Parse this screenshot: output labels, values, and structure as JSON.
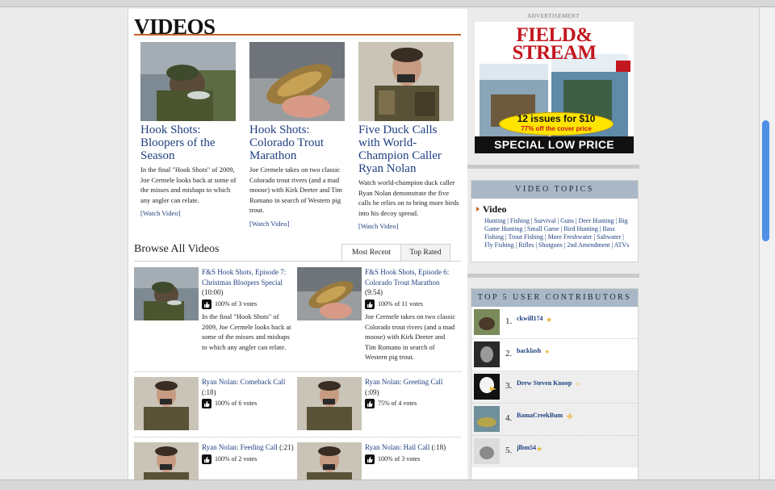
{
  "page": {
    "title": "VIDEOS",
    "features": [
      {
        "title": "Hook Shots: Bloopers of the Season",
        "desc": "In the final \"Hook Shots\" of 2009, Joe Cermele looks back at some of the misses and mishaps to which any angler can relate.",
        "link": "[Watch Video]"
      },
      {
        "title": "Hook Shots: Colorado Trout Marathon",
        "desc": "Joe Cermele takes on two classic Colorado trout rivers (and a mad moose) with Kirk Deeter and Tim Romano in search of Western pig trout.",
        "link": "[Watch Video]"
      },
      {
        "title": "Five Duck Calls with World-Champion Caller Ryan Nolan",
        "desc": "Watch world-champion duck caller Ryan Nolan demonstrate the five calls he relies on to bring more birds into his decoy spread.",
        "link": "[Watch Video]"
      }
    ],
    "browse": {
      "heading": "Browse All Videos",
      "tabs": [
        "Most Recent",
        "Top Rated"
      ],
      "items": [
        {
          "title": "F&S Hook Shots, Episode 7: Christmas Bloopers Special",
          "duration": "(10:00)",
          "rating": "100% of 3 votes",
          "desc": "In the final \"Hook Shots\" of 2009, Joe Cermele looks back at some of the misses and mishaps to which any angler can relate."
        },
        {
          "title": "F&S Hook Shots, Episode 6: Colorado Trout Marathon",
          "duration": "(9:54)",
          "rating": "100% of 11 votes",
          "desc": "Joe Cermele takes on two classic Colorado trout rivers (and a mad moose) with Kirk Deeter and Tim Romano in search of Western pig trout."
        },
        {
          "title": "Ryan Nolan: Comeback Call",
          "duration": "(:18)",
          "rating": "100% of 6 votes",
          "desc": ""
        },
        {
          "title": "Ryan Nolan: Greeting Call",
          "duration": "(:09)",
          "rating": "75% of 4 votes",
          "desc": ""
        },
        {
          "title": "Ryan Nolan: Feeding Call",
          "duration": "(:21)",
          "rating": "100% of 2 votes",
          "desc": ""
        },
        {
          "title": "Ryan Nolan: Hail Call",
          "duration": "(:18)",
          "rating": "100% of 3 votes",
          "desc": ""
        }
      ]
    }
  },
  "sidebar": {
    "ad_label": "ADVERTISEMENT",
    "ad": {
      "logo_line1": "FIELD&",
      "logo_line2": "STREAM",
      "offer": "12 issues for $10",
      "offer_sub": "77% off the cover price",
      "bar": "SPECIAL LOW PRICE"
    },
    "video_topics": {
      "heading": "VIDEO TOPICS",
      "name": "Video",
      "links": "Hunting | Fishing | Survival | Guns | Deer Hunting | Big Game Hunting | Small Game | Bird Hunting | Bass Fishing | Trout Fishing | More Freshwater | Saltwater | Fly Fishing | Rifles | Shotguns | 2nd Amendment | ATVs"
    },
    "contributors": {
      "heading": "TOP 5 USER CONTRIBUTORS",
      "list": [
        {
          "rank": "1.",
          "name": "ckwill174"
        },
        {
          "rank": "2.",
          "name": "backlash"
        },
        {
          "rank": "3.",
          "name": "Drew Steven Knoop"
        },
        {
          "rank": "4.",
          "name": "BamaCreekBum"
        },
        {
          "rank": "5.",
          "name": "jlbm54"
        }
      ]
    }
  },
  "colors": {
    "accent": "#c4622b",
    "link": "#1f3f80",
    "panel_head": "#a9b7c7",
    "ad_red": "#c3171f",
    "scroll_thumb": "#4f8fe6"
  }
}
